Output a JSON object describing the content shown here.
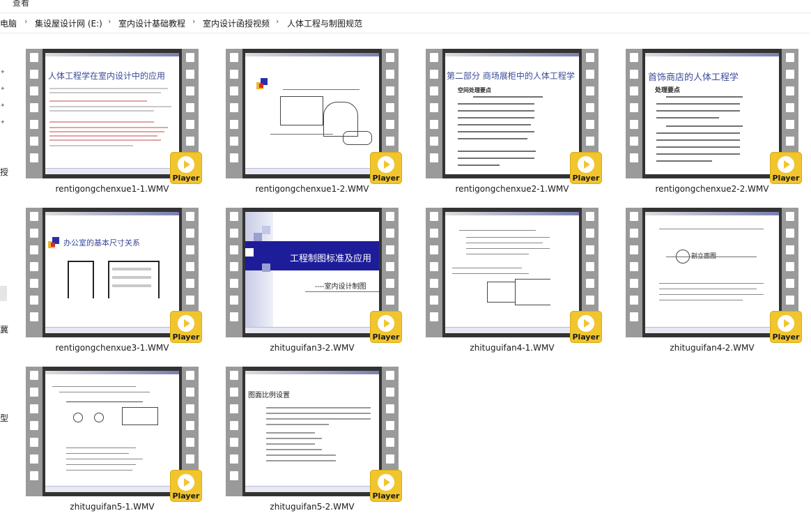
{
  "menu": {
    "view_label": "查看"
  },
  "breadcrumb": [
    "电脑",
    "集设屋设计网 (E:)",
    "室内设计基础教程",
    "室内设计函授视频",
    "人体工程与制图规范"
  ],
  "sidebar": {
    "chars": [
      "授",
      "冀",
      "型"
    ]
  },
  "badge": {
    "label": "Player",
    "color": "#f1c52e"
  },
  "files": [
    {
      "name": "rentigongchenxue1-1.WMV",
      "slide_title": "人体工程学在室内设计中的应用"
    },
    {
      "name": "rentigongchenxue1-2.WMV",
      "slide_title": ""
    },
    {
      "name": "rentigongchenxue2-1.WMV",
      "slide_title": "第二部分 商场展柜中的人体工程学",
      "slide_sub": "空间处理要点"
    },
    {
      "name": "rentigongchenxue2-2.WMV",
      "slide_title": "首饰商店的人体工程学",
      "slide_sub": "处理要点"
    },
    {
      "name": "rentigongchenxue3-1.WMV",
      "slide_title": "办公室的基本尺寸关系"
    },
    {
      "name": "zhituguifan3-2.WMV",
      "slide_title": "工程制图标准及应用",
      "slide_sub": "----室内设计制图"
    },
    {
      "name": "zhituguifan4-1.WMV",
      "slide_title": ""
    },
    {
      "name": "zhituguifan4-2.WMV",
      "slide_title": "",
      "slide_sub": "剖立面图"
    },
    {
      "name": "zhituguifan5-1.WMV",
      "slide_title": ""
    },
    {
      "name": "zhituguifan5-2.WMV",
      "slide_title": "图面比例设置"
    }
  ]
}
